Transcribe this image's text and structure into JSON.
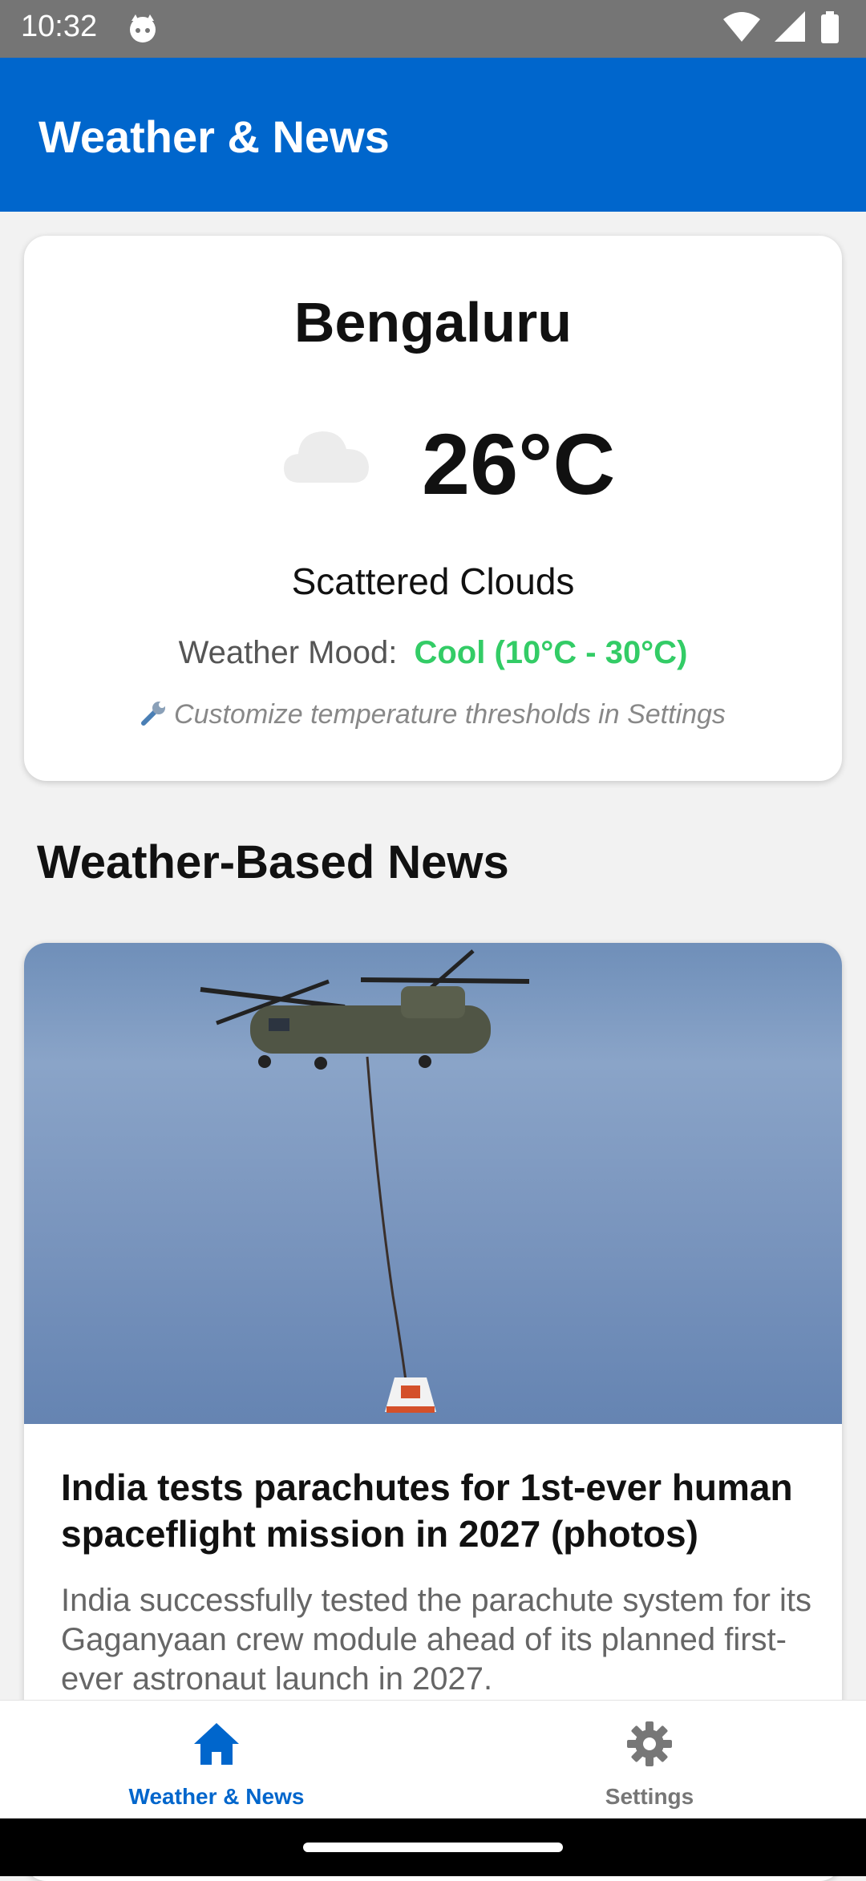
{
  "status_bar": {
    "time": "10:32",
    "icons": [
      "cat-notification-icon",
      "wifi-icon",
      "cellular-signal-icon",
      "battery-icon"
    ]
  },
  "app_bar": {
    "title": "Weather & News"
  },
  "weather": {
    "city": "Bengaluru",
    "temperature": "26°C",
    "icon": "cloud-icon",
    "description": "Scattered Clouds",
    "mood_label": "Weather Mood:",
    "mood_value": "Cool (10°C - 30°C)",
    "customize_hint": "Customize temperature thresholds in Settings",
    "hint_icon": "wrench-icon"
  },
  "news_section": {
    "title": "Weather-Based News",
    "articles": [
      {
        "image": "helicopter-parachute-test-photo",
        "headline": "India tests parachutes for 1st-ever human spaceflight mission in 2027 (photos)",
        "summary": "India successfully tested the parachute system for its Gaganyaan crew module ahead of its planned first-ever astronaut launch in 2027."
      }
    ]
  },
  "bottom_nav": {
    "items": [
      {
        "label": "Weather & News",
        "icon": "home-icon",
        "active": true
      },
      {
        "label": "Settings",
        "icon": "gear-icon",
        "active": false
      }
    ]
  },
  "colors": {
    "primary": "#0066cc",
    "status_bar": "#757575",
    "mood_cool": "#33cc66",
    "background": "#f2f2f2"
  }
}
